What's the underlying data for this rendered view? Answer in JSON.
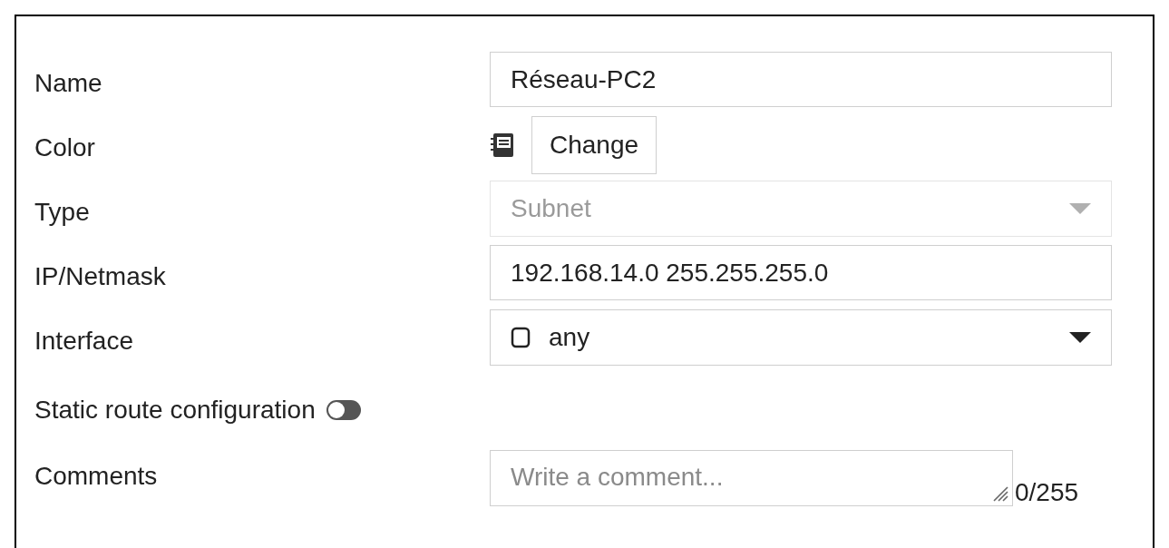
{
  "fields": [
    {
      "kind": "text",
      "label": "Name",
      "value": "Réseau-PC2"
    },
    {
      "kind": "color",
      "label": "Color",
      "button": "Change"
    },
    {
      "kind": "select",
      "label": "Type",
      "value": "Subnet",
      "disabled": true
    },
    {
      "kind": "text",
      "label": "IP/Netmask",
      "value": "192.168.14.0 255.255.255.0"
    },
    {
      "kind": "select",
      "label": "Interface",
      "value": "any",
      "disabled": false
    },
    {
      "kind": "toggle",
      "label": "Static route configuration",
      "on": false
    },
    {
      "kind": "textarea",
      "label": "Comments",
      "placeholder": "Write a comment...",
      "counter": "0/255"
    }
  ]
}
